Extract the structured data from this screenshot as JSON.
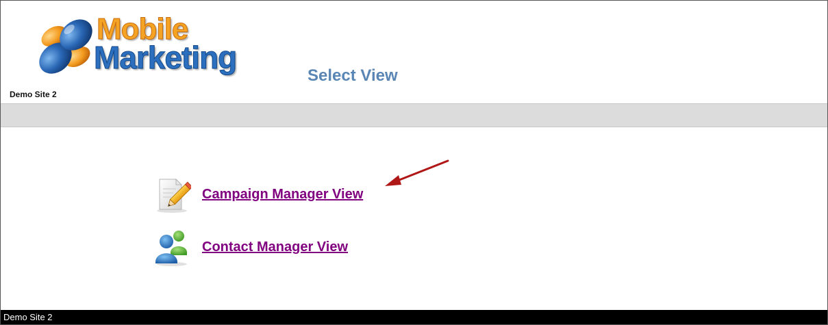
{
  "header": {
    "logo_line1": "Mobile",
    "logo_line2": "Marketing",
    "site_name": "Demo Site 2",
    "page_title": "Select View"
  },
  "views": [
    {
      "label": "Campaign Manager View",
      "icon": "edit-document-icon"
    },
    {
      "label": "Contact Manager View",
      "icon": "contacts-icon"
    }
  ],
  "annotation": {
    "icon": "red-arrow-pointer"
  },
  "footer": {
    "text": "Demo Site 2"
  },
  "colors": {
    "title": "#5a86b5",
    "link_visited": "#800080",
    "nav_bar": "#dcdcdc",
    "footer_bg": "#000000",
    "logo_orange": "#f5a324",
    "logo_blue": "#2c6fbf",
    "annotation_red": "#b01818"
  }
}
